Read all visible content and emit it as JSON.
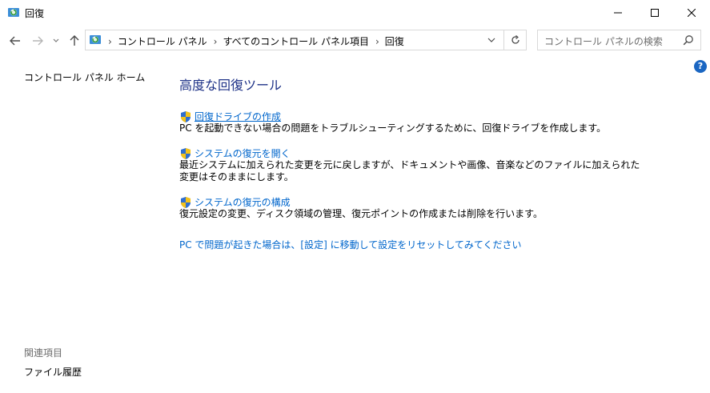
{
  "window": {
    "title": "回復"
  },
  "titlebar_buttons": {
    "minimize": "minimize-icon",
    "maximize": "maximize-icon",
    "close": "close-icon"
  },
  "nav": {
    "breadcrumbs": [
      "コントロール パネル",
      "すべてのコントロール パネル項目",
      "回復"
    ],
    "separator": "›"
  },
  "search": {
    "placeholder": "コントロール パネルの検索"
  },
  "help": {
    "label": "?"
  },
  "sidebar": {
    "home_link": "コントロール パネル ホーム",
    "related_title": "関連項目",
    "related_items": [
      "ファイル履歴"
    ]
  },
  "main": {
    "heading": "高度な回復ツール",
    "tasks": [
      {
        "link": "回復ドライブの作成",
        "desc": "PC を起動できない場合の問題をトラブルシューティングするために、回復ドライブを作成します。"
      },
      {
        "link": "システムの復元を開く",
        "desc": "最近システムに加えられた変更を元に戻しますが、ドキュメントや画像、音楽などのファイルに加えられた変更はそのままにします。"
      },
      {
        "link": "システムの復元の構成",
        "desc": "復元設定の変更、ディスク領域の管理、復元ポイントの作成または削除を行います。"
      }
    ],
    "bottom_link": "PC で問題が起きた場合は、[設定] に移動して設定をリセットしてみてください"
  },
  "colors": {
    "link": "#0066cc",
    "heading": "#1e3287",
    "help": "#1a66c2"
  }
}
